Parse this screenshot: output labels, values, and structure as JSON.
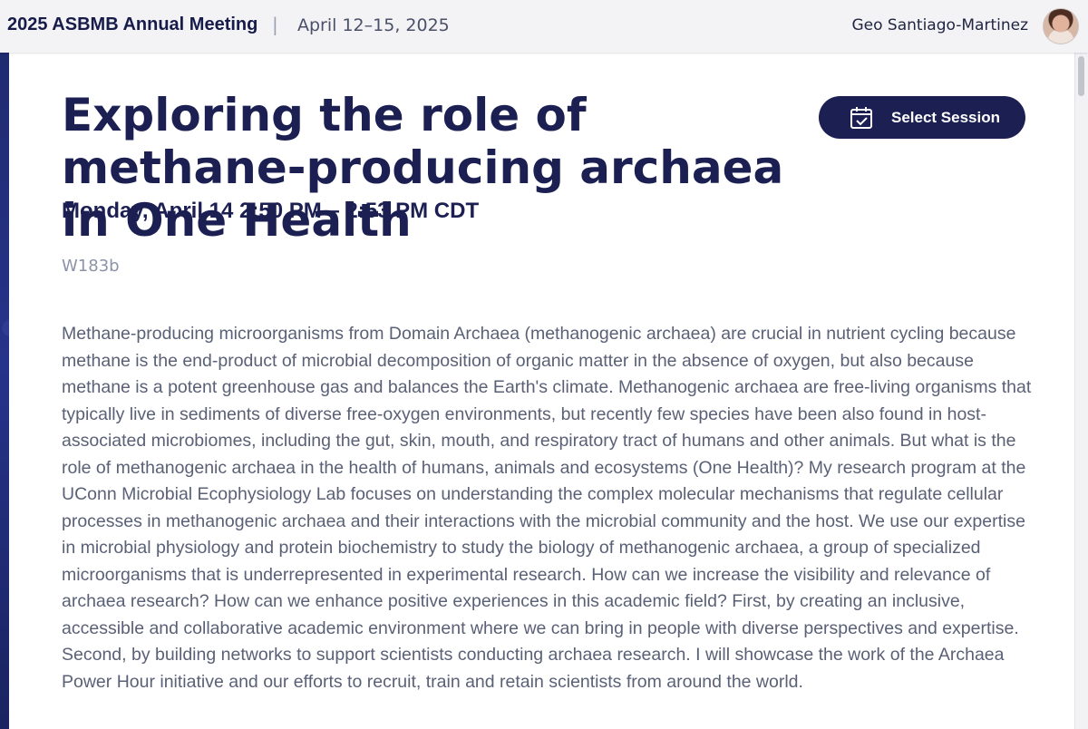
{
  "header": {
    "meeting_name": "2025 ASBMB Annual Meeting",
    "separator": "|",
    "meeting_dates": "April 12–15, 2025",
    "user_name": "Geo Santiago-Martinez"
  },
  "session": {
    "title": "Exploring the role of methane-producing archaea in One Health",
    "datetime": "Monday, April 14 2:50 PM – 2:53 PM CDT",
    "poster_id": "W183b",
    "select_button_label": "Select Session",
    "abstract": "Methane-producing microorganisms from Domain Archaea (methanogenic archaea) are crucial in nutrient cycling because methane is the end-product of microbial decomposition of organic matter in the absence of oxygen, but also because methane is a potent greenhouse gas and balances the Earth's climate. Methanogenic archaea are free-living organisms that typically live in sediments of diverse free-oxygen environments, but recently few species have been also found in host-associated microbiomes, including the gut, skin, mouth, and respiratory tract of humans and other animals. But what is the role of methanogenic archaea in the health of humans, animals and ecosystems (One Health)? My research program at the UConn Microbial Ecophysiology Lab focuses on understanding the complex molecular mechanisms that regulate cellular processes in methanogenic archaea and their interactions with the microbial community and the host. We use our expertise in microbial physiology and protein biochemistry to study the biology of methanogenic archaea, a group of specialized microorganisms that is underrepresented in experimental research. How can we increase the visibility and relevance of archaea research? How can we enhance positive experiences in this academic field? First, by creating an inclusive, accessible and collaborative academic environment where we can bring in people with diverse perspectives and expertise. Second, by building networks to support scientists conducting archaea research. I will showcase the work of the Archaea Power Hour initiative and our efforts to recruit, train and retain scientists from around the world."
  },
  "icons": {
    "calendar": "calendar-check-icon",
    "avatar": "user-avatar"
  },
  "colors": {
    "brand_navy": "#1c1f52",
    "header_bg": "#f3f3f6",
    "body_text": "#5a6176",
    "muted_text": "#8b93a7"
  }
}
